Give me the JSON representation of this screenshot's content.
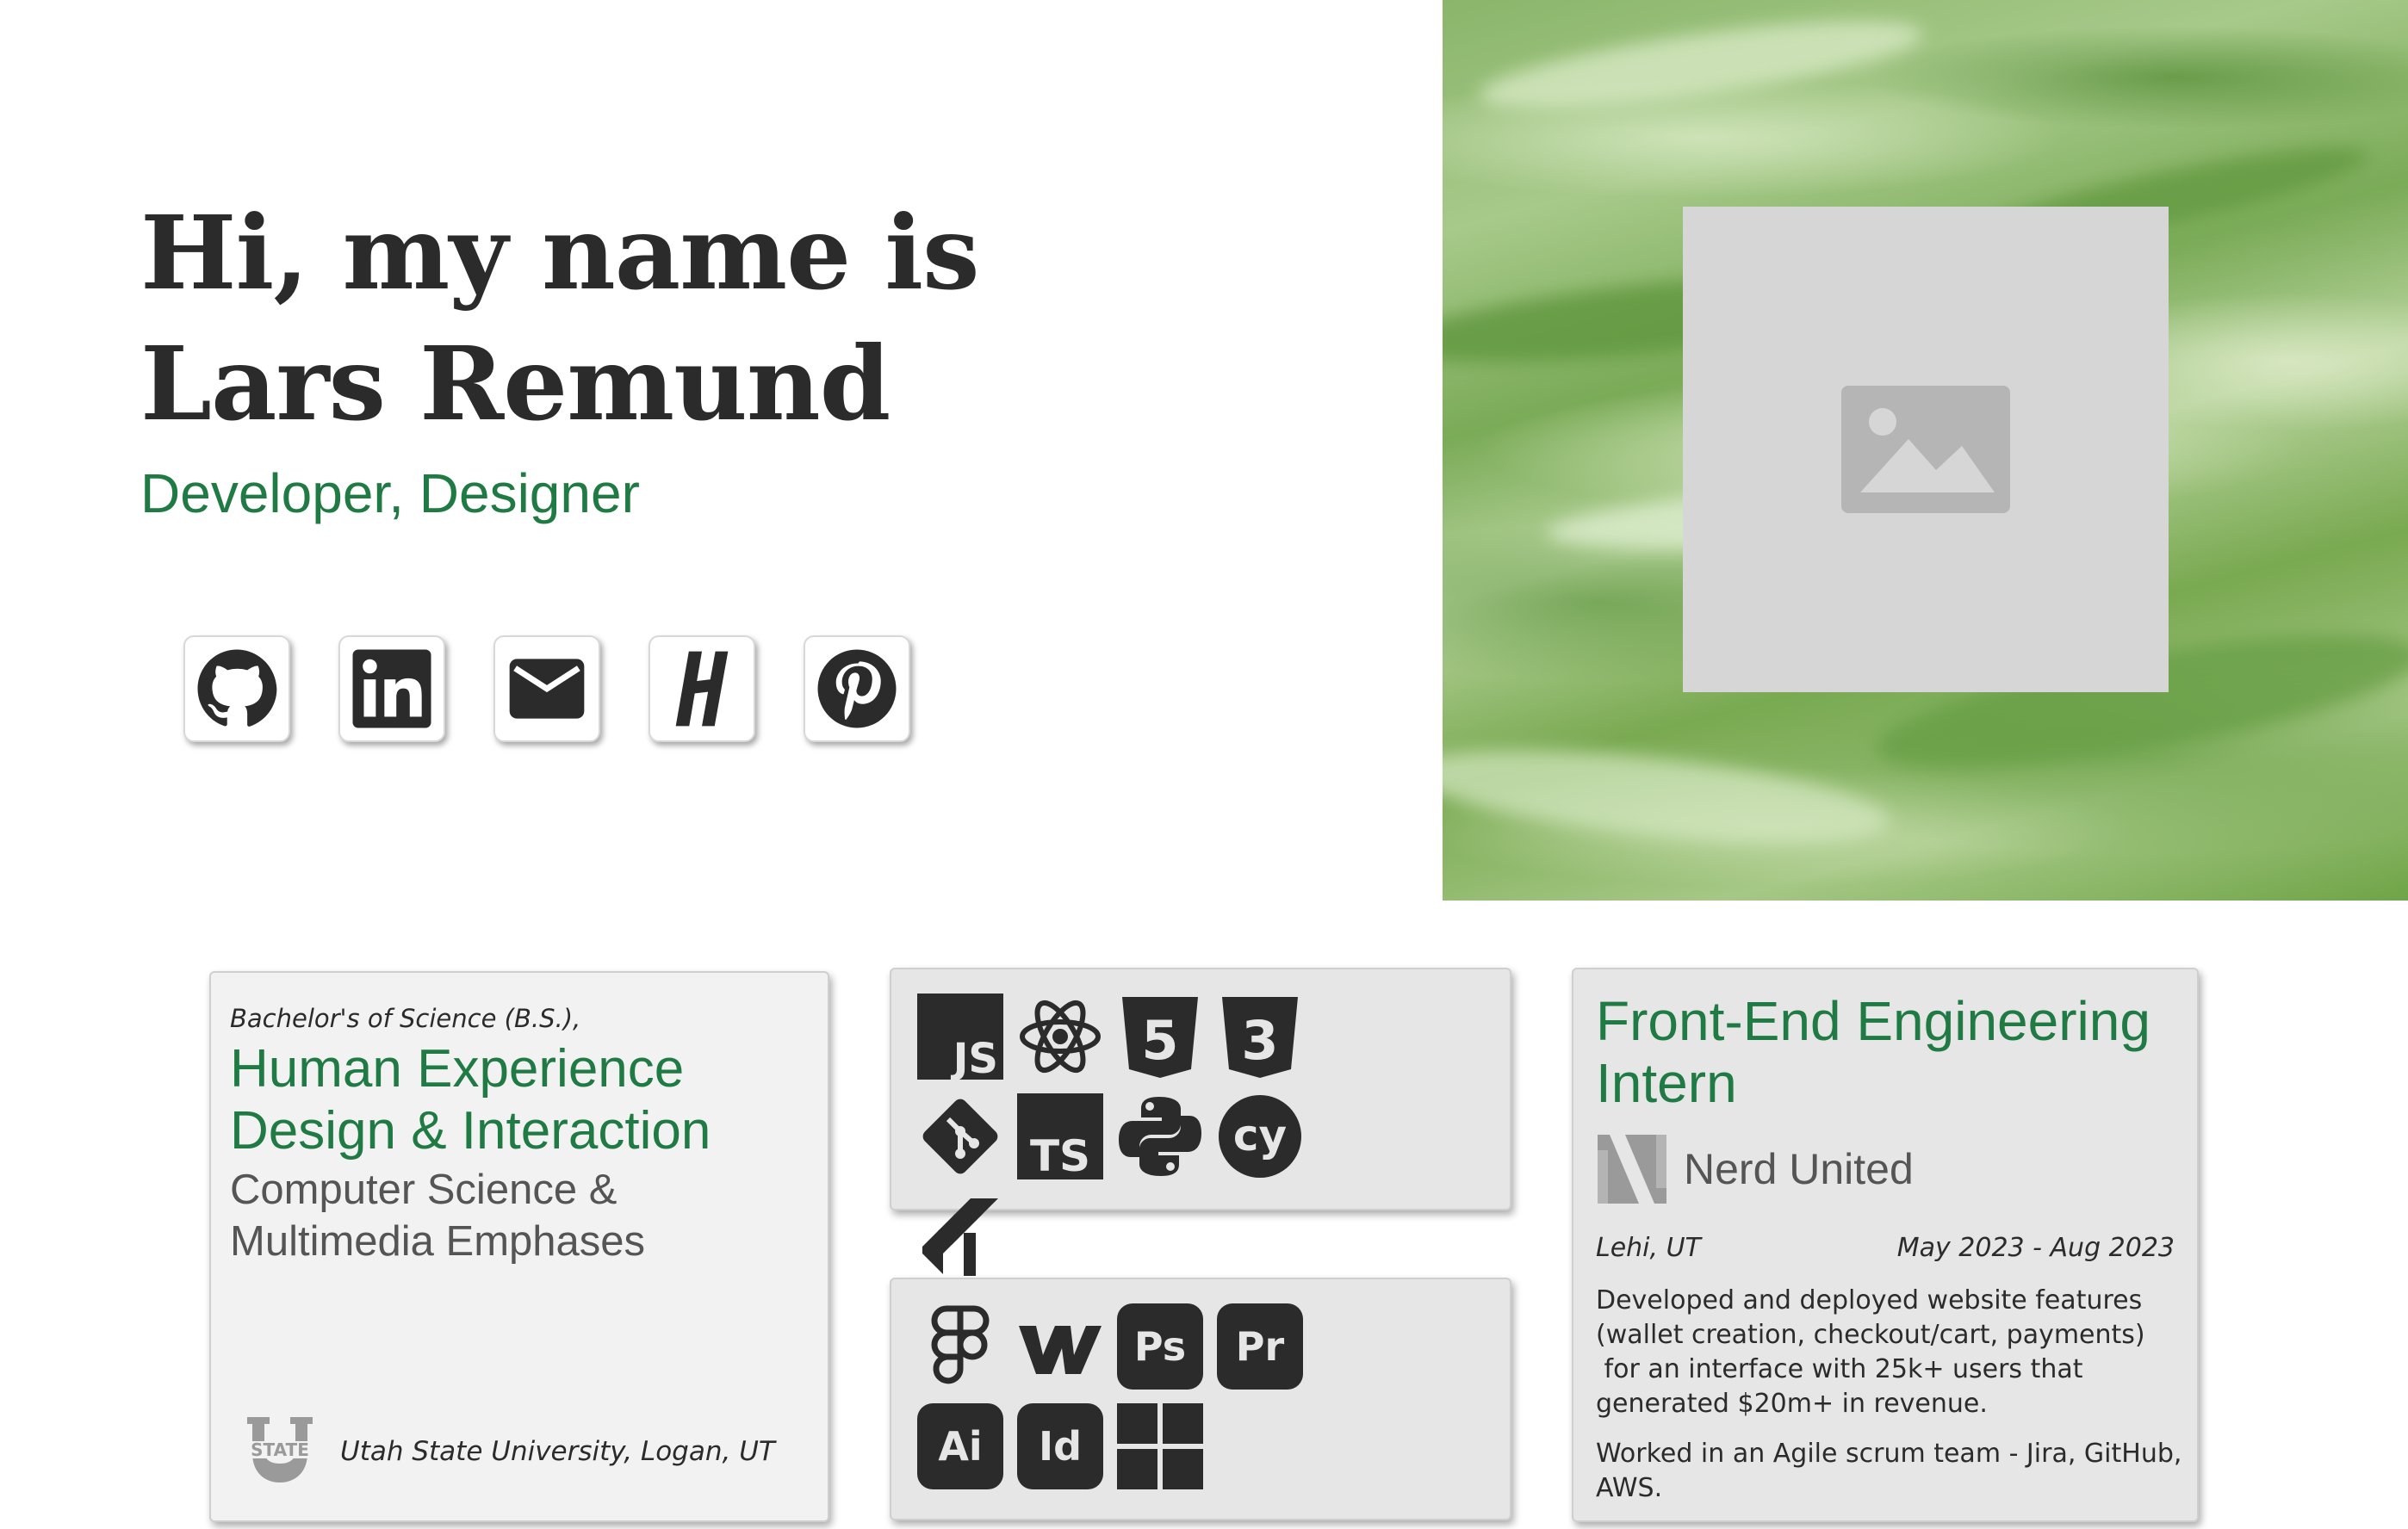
{
  "hero": {
    "title_line1": "Hi, my name is",
    "title_line2": "Lars Remund",
    "subtitle": "Developer, Designer",
    "image_placeholder_icon": "image-icon"
  },
  "socials": [
    {
      "icon": "github-icon"
    },
    {
      "icon": "linkedin-icon"
    },
    {
      "icon": "email-icon"
    },
    {
      "icon": "handshake-icon"
    },
    {
      "icon": "pinterest-icon"
    }
  ],
  "education": {
    "degree": "Bachelor's of Science (B.S.),",
    "major_line1": "Human Experience",
    "major_line2": "Design & Interaction",
    "emphasis_line1": "Computer Science &",
    "emphasis_line2": "Multimedia Emphases",
    "school_logo_text": "STATE",
    "school": "Utah State University, Logan, UT"
  },
  "dev_skills": {
    "items": [
      {
        "icon": "javascript-icon",
        "text": "JS"
      },
      {
        "icon": "react-icon"
      },
      {
        "icon": "html5-icon",
        "text": "5"
      },
      {
        "icon": "css3-icon",
        "text": "3"
      },
      {
        "icon": "git-icon"
      },
      {
        "icon": "typescript-icon",
        "text": "TS"
      },
      {
        "icon": "python-icon"
      },
      {
        "icon": "cypress-icon",
        "text": "cy"
      },
      {
        "icon": "jira-icon"
      }
    ]
  },
  "design_skills": {
    "items": [
      {
        "icon": "figma-icon"
      },
      {
        "icon": "webflow-icon",
        "text": "W"
      },
      {
        "icon": "photoshop-icon",
        "text": "Ps"
      },
      {
        "icon": "premiere-icon",
        "text": "Pr"
      },
      {
        "icon": "illustrator-icon",
        "text": "Ai"
      },
      {
        "icon": "indesign-icon",
        "text": "Id"
      },
      {
        "icon": "windows-icon"
      }
    ]
  },
  "experience": {
    "title_line1": "Front-End Engineering",
    "title_line2": "Intern",
    "company": "Nerd United",
    "location": "Lehi, UT",
    "dates": "May 2023 - Aug 2023",
    "desc1_line1": "Developed and deployed website features",
    "desc1_line2": "(wallet creation, checkout/cart, payments)",
    "desc1_line3": " for an interface with 25k+ users that",
    "desc1_line4": "generated $20m+ in revenue.",
    "desc2_line1": "Worked in an Agile scrum team - Jira, GitHub,",
    "desc2_line2": "AWS."
  },
  "colors": {
    "accent": "#207a44",
    "text": "#2b2b2b",
    "card_bg": "#f2f2f2",
    "icon_dark": "#2b2b2b"
  }
}
